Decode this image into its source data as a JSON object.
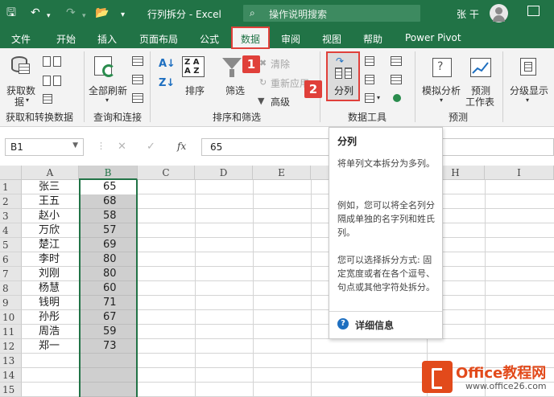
{
  "titlebar": {
    "save_icon": "save-icon",
    "filename": "行列拆分",
    "separator": "-",
    "app": "Excel",
    "search_placeholder": "操作说明搜索",
    "user": "张 干"
  },
  "tabs": [
    "文件",
    "开始",
    "插入",
    "页面布局",
    "公式",
    "数据",
    "审阅",
    "视图",
    "帮助",
    "Power Pivot"
  ],
  "active_tab": "数据",
  "ribbon": {
    "get_data_line1": "获取数",
    "get_data_line2": "据",
    "refresh_all": "全部刷新",
    "sort": "排序",
    "filter": "筛选",
    "clear": "清除",
    "reapply": "重新应用",
    "advanced": "高级",
    "text_to_columns": "分列",
    "what_if": "模拟分析",
    "forecast_line1": "预测",
    "forecast_line2": "工作表",
    "outline": "分级显示",
    "groups": {
      "get_transform": "获取和转换数据",
      "queries": "查询和连接",
      "sort_filter": "排序和筛选",
      "data_tools": "数据工具",
      "forecast": "预测"
    },
    "step1": "1",
    "step2": "2"
  },
  "formula_bar": {
    "name_box": "B1",
    "fx": "fx",
    "value": "65"
  },
  "columns": [
    "A",
    "B",
    "C",
    "D",
    "E",
    "H",
    "I"
  ],
  "rows": [
    "1",
    "2",
    "3",
    "4",
    "5",
    "6",
    "7",
    "8",
    "9",
    "10",
    "11",
    "12",
    "13",
    "14",
    "15"
  ],
  "names": [
    "张三",
    "王五",
    "赵小",
    "万欣",
    "楚江",
    "李时",
    "刘刚",
    "杨慧",
    "钱明",
    "孙彤",
    "周浩",
    "郑一"
  ],
  "scores": [
    "65",
    "68",
    "58",
    "57",
    "69",
    "80",
    "80",
    "60",
    "71",
    "67",
    "59",
    "73"
  ],
  "tooltip": {
    "title": "分列",
    "p1": "将单列文本拆分为多列。",
    "p2": "例如，您可以将全名列分隔成单独的名字列和姓氏列。",
    "p3": "您可以选择拆分方式: 固定宽度或者在各个逗号、句点或其他字符处拆分。",
    "link": "详细信息"
  },
  "watermark": {
    "brand": "Office教程网",
    "url": "www.office26.com"
  },
  "colors": {
    "excel_green": "#217346",
    "highlight_red": "#e0403a",
    "watermark_orange": "#e24a1b"
  }
}
